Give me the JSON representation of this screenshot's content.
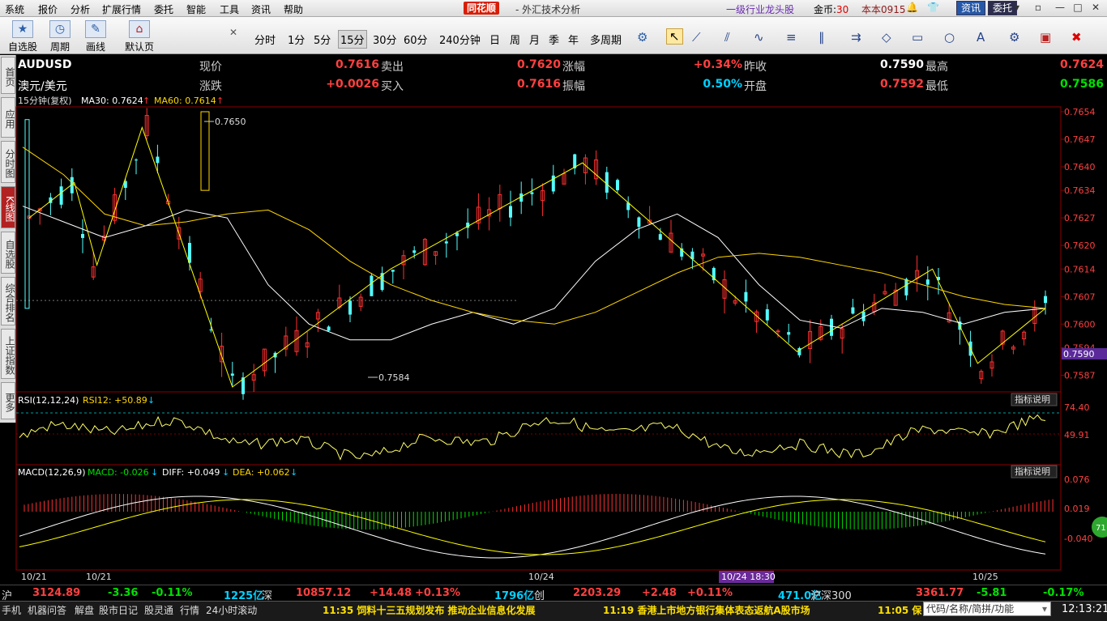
{
  "menu": {
    "items": [
      "系统",
      "报价",
      "分析",
      "扩展行情",
      "委托",
      "智能",
      "工具",
      "资讯",
      "帮助"
    ],
    "brand": "同花顺",
    "app_title": "- 外汇技术分析",
    "promo": "一级行业龙头股",
    "coins_label": "金币:",
    "coins_value": "30",
    "user": "本本0915",
    "zixun": "资讯",
    "weituo": "委托"
  },
  "toolbar": {
    "big_buttons": [
      "自选股",
      "周期",
      "画线",
      "默认页"
    ],
    "periods": [
      "分时",
      "1分",
      "5分",
      "15分",
      "30分",
      "60分",
      "240分钟",
      "日",
      "周",
      "月",
      "季",
      "年",
      "多周期"
    ],
    "selected_period": "15分"
  },
  "sidebar": {
    "tabs": [
      "首页",
      "应用",
      "分时图",
      "K线图",
      "自选股",
      "综合排名",
      "上证指数",
      "更多"
    ],
    "active": "K线图"
  },
  "quote": {
    "symbol": "AUDUSD",
    "name": "澳元/美元",
    "fields": [
      {
        "label": "现价",
        "value": "0.7616"
      },
      {
        "label": "卖出",
        "value": "0.7620"
      },
      {
        "label": "涨幅",
        "value": "+0.34%"
      },
      {
        "label": "昨收",
        "value": "0.7590"
      },
      {
        "label": "最高",
        "value": "0.7624"
      },
      {
        "label": "涨跌",
        "value": "+0.0026"
      },
      {
        "label": "买入",
        "value": "0.7616"
      },
      {
        "label": "振幅",
        "value": "0.50%"
      },
      {
        "label": "开盘",
        "value": "0.7592"
      },
      {
        "label": "最低",
        "value": "0.7586"
      }
    ]
  },
  "chart_info": {
    "period_label": "15分钟(复权)",
    "ma30": "MA30: 0.7624",
    "ma60": "MA60: 0.7614",
    "high_annot": "0.7650",
    "low_annot": "0.7584",
    "current_tag": "0.7590"
  },
  "rsi_info": {
    "label": "RSI(12,12,24)",
    "value": "RSI12: +50.89",
    "help": "指标说明",
    "ticks": [
      "74.40",
      "49.91"
    ]
  },
  "macd_info": {
    "label": "MACD(12,26,9)",
    "macd": "MACD: -0.026",
    "diff": "DIFF: +0.049",
    "dea": "DEA: +0.062",
    "help": "指标说明",
    "ticks": [
      "0.076",
      "0.019",
      "-0.040"
    ]
  },
  "xaxis": {
    "labels": [
      "10/21",
      "10/21",
      "10/24",
      "10/24 18:30",
      "10/25"
    ]
  },
  "chart_data": {
    "type": "line",
    "title": "AUDUSD 15分钟(复权)",
    "ylim": [
      0.7584,
      0.7654
    ],
    "y_ticks": [
      0.7654,
      0.7647,
      0.764,
      0.7634,
      0.7627,
      0.762,
      0.7614,
      0.7607,
      0.76,
      0.7594,
      0.759,
      0.7587
    ],
    "x_labels": [
      "10/21",
      "10/21",
      "10/24",
      "10/24 18:30",
      "10/25"
    ],
    "series": [
      {
        "name": "MA30",
        "values": [
          0.763,
          0.7626,
          0.7622,
          0.7625,
          0.7629,
          0.7627,
          0.761,
          0.76,
          0.7596,
          0.7596,
          0.76,
          0.7603,
          0.76,
          0.7604,
          0.7616,
          0.7624,
          0.7628,
          0.7622,
          0.761,
          0.7601,
          0.7599,
          0.7604,
          0.7603,
          0.76,
          0.7603,
          0.7604
        ]
      },
      {
        "name": "MA60",
        "values": [
          0.7645,
          0.7638,
          0.7628,
          0.7625,
          0.7626,
          0.7628,
          0.7629,
          0.7624,
          0.7616,
          0.761,
          0.7606,
          0.7603,
          0.7601,
          0.76,
          0.7603,
          0.7608,
          0.7613,
          0.7617,
          0.7618,
          0.7617,
          0.7615,
          0.7613,
          0.761,
          0.7607,
          0.7605,
          0.7604
        ]
      },
      {
        "name": "Zigzag",
        "points": [
          [
            0,
            0.7627
          ],
          [
            4,
            0.7636
          ],
          [
            6,
            0.7615
          ],
          [
            10,
            0.765
          ],
          [
            18,
            0.7584
          ],
          [
            32,
            0.7614
          ],
          [
            49,
            0.7641
          ],
          [
            55,
            0.7626
          ],
          [
            68,
            0.7593
          ],
          [
            80,
            0.7614
          ],
          [
            84,
            0.759
          ],
          [
            90,
            0.7604
          ]
        ]
      }
    ]
  }
}
